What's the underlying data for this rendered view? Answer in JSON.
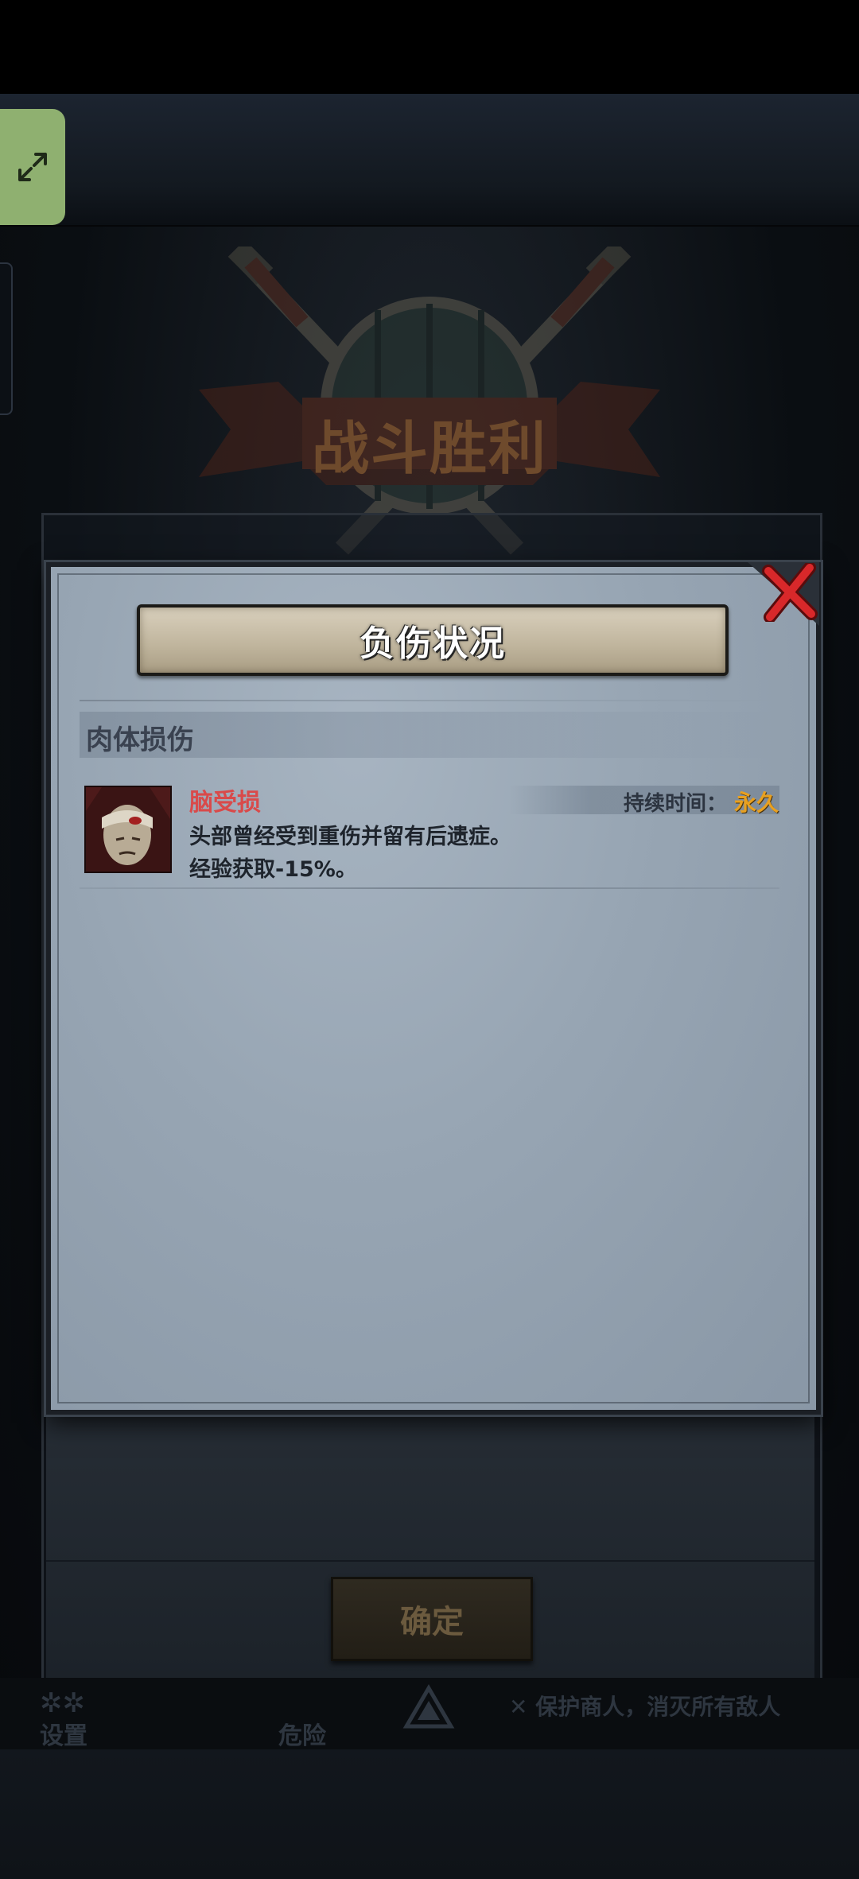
{
  "victory": {
    "banner": "战斗胜利"
  },
  "dialog": {
    "title": "负伤状况",
    "section_title": "肉体损伤",
    "injuries": [
      {
        "name": "脑受损",
        "duration_label": "持续时间：",
        "duration_value": "永久",
        "description_line1": "头部曾经受到重伤并留有后遗症。",
        "description_line2": "经验获取-15%。"
      }
    ]
  },
  "underlying": {
    "confirm_label": "确定",
    "toolbar": {
      "settings_label": "设置",
      "danger_label": "危险",
      "objective_text": "保护商人，消灭所有敌人"
    }
  },
  "colors": {
    "expand_button": "#8fb070",
    "injury_name": "#d94a4a",
    "duration_value": "#e8a020",
    "dialog_bg": "#97a5b3",
    "close_x": "#d8282a"
  },
  "icons": {
    "expand": "expand-arrows-icon",
    "close": "close-x-icon",
    "injury": "bandaged-head-icon",
    "emblem": "crossed-swords-shield-emblem"
  }
}
